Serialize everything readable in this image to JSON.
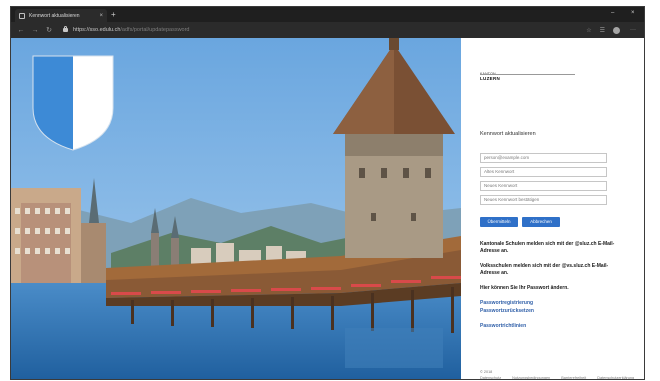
{
  "browser": {
    "tab_title": "Kennwort aktualisieren",
    "tab_close": "×",
    "new_tab": "+",
    "url_host": "https://sso.edulu.ch",
    "url_path": "/adfs/portal/updatepassword",
    "minimize": "–",
    "close": "×"
  },
  "logo": {
    "line1": "KANTON",
    "line2": "LUZERN"
  },
  "form": {
    "title": "Kennwort aktualisieren",
    "username_placeholder": "person@example.com",
    "old_password_placeholder": "Altes Kennwort",
    "new_password_placeholder": "Neues Kennwort",
    "confirm_password_placeholder": "Neues Kennwort bestätigen",
    "submit_label": "Übermitteln",
    "cancel_label": "Abbrechen"
  },
  "info": {
    "line1": "Kantonale Schulen melden sich mit der @sluz.ch E-Mail-Adresse an.",
    "line2": "Volksschulen melden sich mit der @vs.sluz.ch E-Mail-Adresse an.",
    "line3": "Hier können Sie Ihr Passwort ändern."
  },
  "links": {
    "registration": "Passwortregistrierung",
    "reset": "Passwortzurücksetzen",
    "guidelines": "Passwortrichtlinien"
  },
  "footer": {
    "copyright": "© 2018",
    "links": [
      "Datenschutz",
      "Nutzungsbedingungen",
      "Barrierefreiheit",
      "Datenschutzerklärung"
    ]
  },
  "colors": {
    "primary_button": "#2f70c8",
    "link": "#2f5fa8",
    "crest_blue": "#3d8ad6"
  }
}
